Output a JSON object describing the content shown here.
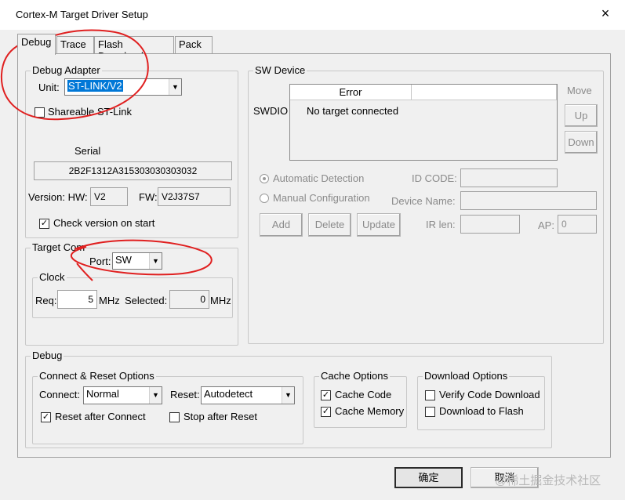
{
  "window": {
    "title": "Cortex-M Target Driver Setup",
    "close_glyph": "×"
  },
  "tabs": [
    {
      "label": "Debug",
      "active": true
    },
    {
      "label": "Trace"
    },
    {
      "label": "Flash Download"
    },
    {
      "label": "Pack"
    }
  ],
  "debug_adapter": {
    "title": "Debug Adapter",
    "unit_label": "Unit:",
    "unit_value": "ST-LINK/V2",
    "shareable_label": "Shareable ST-Link",
    "shareable_checked": false,
    "serial_label": "Serial",
    "serial_value": "2B2F1312A315303030303032",
    "version_label": "Version: HW:",
    "hw_value": "V2",
    "fw_label": "FW:",
    "fw_value": "V2J37S7",
    "check_version_label": "Check version on start",
    "check_version_checked": true
  },
  "target_com": {
    "title": "Target Com",
    "port_label": "Port:",
    "port_value": "SW",
    "clock_title": "Clock",
    "req_label": "Req:",
    "req_value": "5",
    "req_unit": "MHz",
    "selected_label": "Selected:",
    "selected_value": "0",
    "selected_unit": "MHz"
  },
  "sw_device": {
    "title": "SW Device",
    "swdio_label": "SWDIO",
    "col_error": "Error",
    "row_text": "No target connected",
    "move_label": "Move",
    "up_label": "Up",
    "down_label": "Down",
    "auto_detect_label": "Automatic Detection",
    "manual_config_label": "Manual Configuration",
    "id_code_label": "ID CODE:",
    "device_name_label": "Device Name:",
    "ir_len_label": "IR len:",
    "ap_label": "AP:",
    "ap_value": "0",
    "add_label": "Add",
    "delete_label": "Delete",
    "update_label": "Update"
  },
  "debug": {
    "title": "Debug",
    "connect_reset": {
      "title": "Connect & Reset Options",
      "connect_label": "Connect:",
      "connect_value": "Normal",
      "reset_label": "Reset:",
      "reset_value": "Autodetect",
      "reset_after_connect_label": "Reset after Connect",
      "reset_after_connect_checked": true,
      "stop_after_reset_label": "Stop after Reset",
      "stop_after_reset_checked": false
    },
    "cache": {
      "title": "Cache Options",
      "cache_code_label": "Cache Code",
      "cache_code_checked": true,
      "cache_memory_label": "Cache Memory",
      "cache_memory_checked": true
    },
    "download": {
      "title": "Download Options",
      "verify_label": "Verify Code Download",
      "verify_checked": false,
      "download_flash_label": "Download to Flash",
      "download_flash_checked": false
    }
  },
  "footer": {
    "ok_label": "确定",
    "cancel_label": "取消"
  },
  "watermark": "@稀土掘金技术社区",
  "check_glyph": "✓",
  "dropdown_glyph": "▼",
  "annotation_color": "#e02020"
}
